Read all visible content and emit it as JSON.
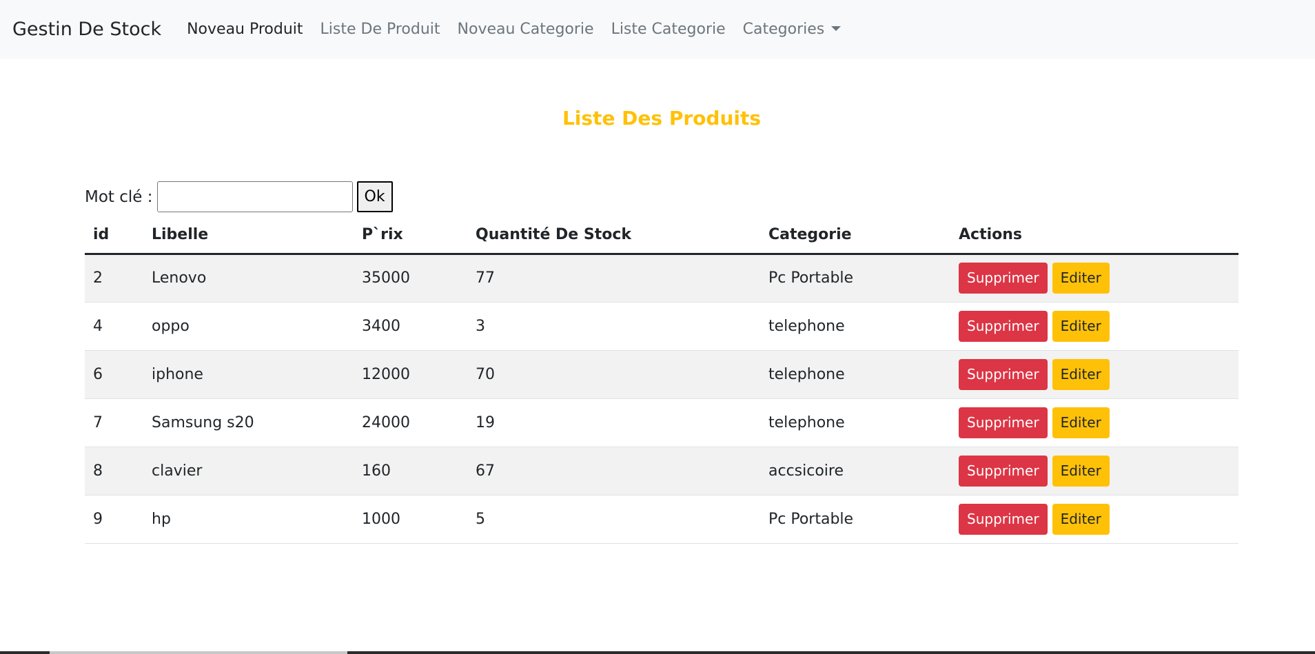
{
  "navbar": {
    "brand": "Gestin De Stock",
    "items": [
      {
        "label": "Noveau Produit",
        "active": true
      },
      {
        "label": "Liste De Produit",
        "active": false
      },
      {
        "label": "Noveau Categorie",
        "active": false
      },
      {
        "label": "Liste Categorie",
        "active": false
      },
      {
        "label": "Categories",
        "active": false
      }
    ]
  },
  "page_title": "Liste Des Produits",
  "search": {
    "label": "Mot clé :",
    "value": "",
    "button": "Ok"
  },
  "table": {
    "headers": [
      "id",
      "Libelle",
      "P`rix",
      "Quantité De Stock",
      "Categorie",
      "Actions"
    ],
    "rows": [
      {
        "id": "2",
        "libelle": "Lenovo",
        "prix": "35000",
        "quantite": "77",
        "categorie": "Pc Portable"
      },
      {
        "id": "4",
        "libelle": "oppo",
        "prix": "3400",
        "quantite": "3",
        "categorie": "telephone"
      },
      {
        "id": "6",
        "libelle": "iphone",
        "prix": "12000",
        "quantite": "70",
        "categorie": "telephone"
      },
      {
        "id": "7",
        "libelle": "Samsung s20",
        "prix": "24000",
        "quantite": "19",
        "categorie": "telephone"
      },
      {
        "id": "8",
        "libelle": "clavier",
        "prix": "160",
        "quantite": "67",
        "categorie": "accsicoire"
      },
      {
        "id": "9",
        "libelle": "hp",
        "prix": "1000",
        "quantite": "5",
        "categorie": "Pc Portable"
      }
    ],
    "delete_label": "Supprimer",
    "edit_label": "Editer"
  },
  "colors": {
    "title": "#ffc107",
    "danger": "#dc3545",
    "warning": "#ffc107",
    "navbar_bg": "#f8f9fa"
  }
}
